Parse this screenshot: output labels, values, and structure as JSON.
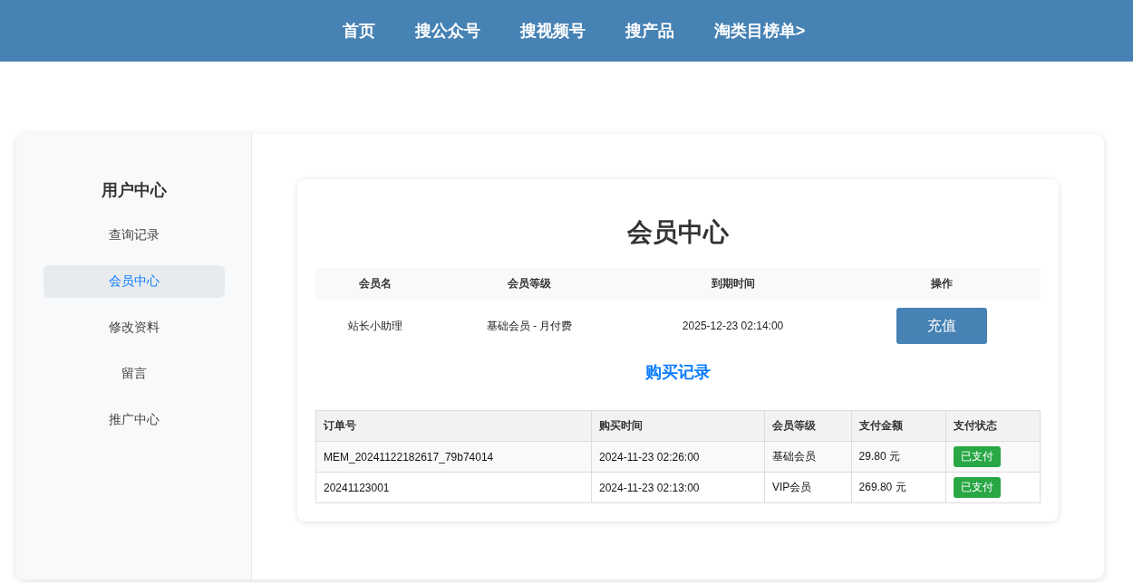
{
  "nav": {
    "items": [
      "首页",
      "搜公众号",
      "搜视频号",
      "搜产品",
      "淘类目榜单>"
    ]
  },
  "sidebar": {
    "title": "用户中心",
    "items": [
      {
        "label": "查询记录",
        "selected": false
      },
      {
        "label": "会员中心",
        "selected": true
      },
      {
        "label": "修改资料",
        "selected": false
      },
      {
        "label": "留言",
        "selected": false
      },
      {
        "label": "推广中心",
        "selected": false
      }
    ]
  },
  "member": {
    "title": "会员中心",
    "columns": [
      "会员名",
      "会员等级",
      "到期时间",
      "操作"
    ],
    "row": {
      "name": "站长小助理",
      "level": "基础会员 - 月付费",
      "expires": "2025-12-23 02:14:00",
      "action": "充值"
    }
  },
  "purchases": {
    "title": "购买记录",
    "columns": [
      "订单号",
      "购买时间",
      "会员等级",
      "支付金额",
      "支付状态"
    ],
    "rows": [
      {
        "order": "MEM_20241122182617_79b74014",
        "time": "2024-11-23 02:26:00",
        "level": "基础会员",
        "amount": "29.80 元",
        "status": "已支付",
        "paid": true
      },
      {
        "order": "20241123001",
        "time": "2024-11-23 02:13:00",
        "level": "VIP会员",
        "amount": "269.80 元",
        "status": "已支付",
        "paid": true
      }
    ]
  }
}
